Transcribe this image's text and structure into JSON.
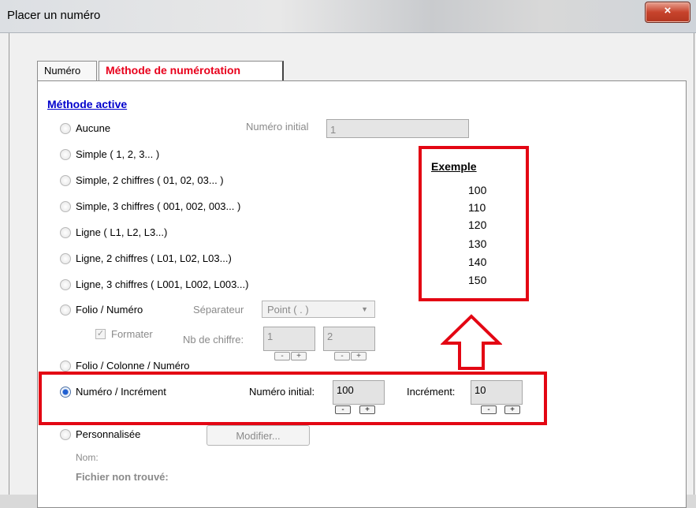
{
  "window": {
    "title": "Placer un numéro",
    "close_icon": "×"
  },
  "tabs": [
    {
      "label": "Numéro"
    },
    {
      "label": "Méthode de numérotation"
    }
  ],
  "section_title": "Méthode active",
  "methods": [
    {
      "label": "Aucune",
      "selected": false
    },
    {
      "label": "Simple ( 1, 2, 3... )",
      "selected": false
    },
    {
      "label": "Simple, 2 chiffres ( 01, 02, 03... )",
      "selected": false
    },
    {
      "label": "Simple, 3 chiffres ( 001, 002, 003... )",
      "selected": false
    },
    {
      "label": "Ligne ( L1, L2, L3...)",
      "selected": false
    },
    {
      "label": "Ligne, 2 chiffres ( L01, L02, L03...)",
      "selected": false
    },
    {
      "label": "Ligne, 3 chiffres ( L001, L002, L003...)",
      "selected": false
    },
    {
      "label": "Folio / Numéro",
      "selected": false
    },
    {
      "label": "Folio / Colonne / Numéro",
      "selected": false
    },
    {
      "label": "Numéro / Incrément",
      "selected": true
    },
    {
      "label": "Personnalisée",
      "selected": false
    }
  ],
  "aucune": {
    "label": "Numéro initial",
    "value": "1"
  },
  "folio": {
    "separator_label": "Séparateur",
    "separator_value": "Point ( . )",
    "formater_label": "Formater",
    "formater_checked": true,
    "nb_label": "Nb de chiffre:",
    "nb1": "1",
    "nb2": "2"
  },
  "increment": {
    "initial_label": "Numéro initial:",
    "initial_value": "100",
    "increment_label": "Incrément:",
    "increment_value": "10"
  },
  "stepper": {
    "minus": "-",
    "plus": "+"
  },
  "personnalisee": {
    "button": "Modifier...",
    "nom_label": "Nom:",
    "file_status": "Fichier non trouvé:"
  },
  "exemple": {
    "title": "Exemple",
    "values": [
      "100",
      "110",
      "120",
      "130",
      "140",
      "150"
    ]
  },
  "annotation_color": "#e30613",
  "arrow_icon": "up-arrow-icon"
}
